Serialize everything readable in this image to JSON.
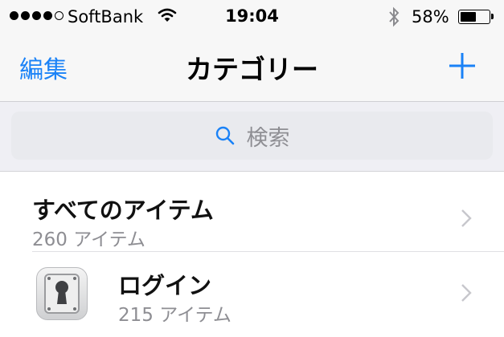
{
  "status_bar": {
    "carrier": "SoftBank",
    "time": "19:04",
    "battery_percent": "58%",
    "battery_level": 0.58,
    "signal_bars_filled": 4,
    "signal_bars_total": 5,
    "icons": [
      "signal-dots-icon",
      "wifi-icon",
      "bluetooth-icon",
      "battery-icon"
    ]
  },
  "nav": {
    "edit_label": "編集",
    "title": "カテゴリー",
    "add_icon": "plus-icon"
  },
  "search": {
    "placeholder": "検索",
    "icon": "search-icon"
  },
  "list": {
    "items": [
      {
        "title": "すべてのアイテム",
        "count": "260 アイテム"
      },
      {
        "title": "ログイン",
        "count": "215 アイテム",
        "icon": "keyhole-safe-icon"
      }
    ]
  },
  "colors": {
    "accent": "#1a82f7",
    "nav_bg": "#f7f7f7",
    "search_bg": "#efeff4",
    "secondary_text": "#8e8e93"
  }
}
